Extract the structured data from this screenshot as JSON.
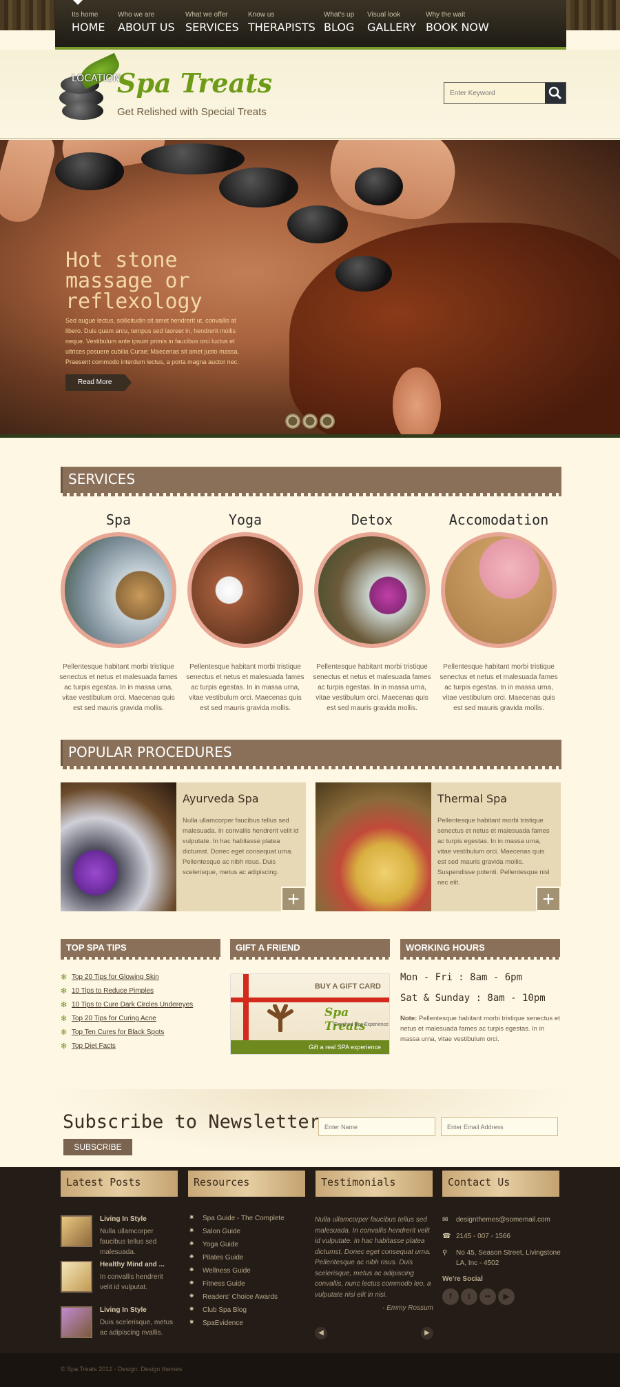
{
  "nav": [
    {
      "sub": "Its home",
      "label": "HOME"
    },
    {
      "sub": "Who we are",
      "label": "ABOUT US"
    },
    {
      "sub": "What we offer",
      "label": "SERVICES"
    },
    {
      "sub": "Know us",
      "label": "THERAPISTS"
    },
    {
      "sub": "What's up",
      "label": "BLOG"
    },
    {
      "sub": "Visual look",
      "label": "GALLERY"
    },
    {
      "sub": "Why the wait",
      "label": "BOOK NOW"
    }
  ],
  "logo": {
    "location": "LOCATION",
    "title": "Spa Treats",
    "tagline": "Get Relished with Special Treats"
  },
  "search": {
    "placeholder": "Enter Keyword"
  },
  "hero": {
    "title": "Hot stone massage or reflexology",
    "text": "Sed augue lectus, sollicitudin sit amet hendrerit ut, convallis at libero. Duis quam arcu, tempus sed laoreet in, hendrerit mollis neque. Vestibulum ante ipsum primis in faucibus orci luctus et ultrices posuere cubilia Curae; Maecenas sit amet justo massa. Praesent commodo interdum lectus, a porta magna auctor nec.",
    "button": "Read More"
  },
  "services": {
    "heading": "SERVICES",
    "items": [
      {
        "label": "Spa",
        "desc": "Pellentesque habitant morbi tristique senectus et netus et malesuada fames ac turpis egestas. In in massa urna, vitae vestibulum orci. Maecenas quis est sed mauris gravida mollis."
      },
      {
        "label": "Yoga",
        "desc": "Pellentesque habitant morbi tristique senectus et netus et malesuada fames ac turpis egestas. In in massa urna, vitae vestibulum orci. Maecenas quis est sed mauris gravida mollis."
      },
      {
        "label": "Detox",
        "desc": "Pellentesque habitant morbi tristique senectus et netus et malesuada fames ac turpis egestas. In in massa urna, vitae vestibulum orci. Maecenas quis est sed mauris gravida mollis."
      },
      {
        "label": "Accomodation",
        "desc": "Pellentesque habitant morbi tristique senectus et netus et malesuada fames ac turpis egestas. In in massa urna, vitae vestibulum orci. Maecenas quis est sed mauris gravida mollis."
      }
    ]
  },
  "procedures": {
    "heading": "POPULAR PROCEDURES",
    "items": [
      {
        "title": "Ayurveda Spa",
        "text": "Nulla ullamcorper faucibus tellus sed malesuada. In convallis hendrerit velit id vulputate. In hac habitasse platea dictumst. Donec eget consequat urna. Pellentesque ac nibh risus. Duis scelerisque, metus ac adipiscing."
      },
      {
        "title": "Thermal Spa",
        "text": "Pellentesque habitant morbi tristique senectus et netus et malesuada fames ac turpis egestas. In in massa urna, vitae vestibulum orci. Maecenas quis est sed mauris gravida mollis. Suspendisse potenti. Pellentesque nisl nec elit."
      }
    ]
  },
  "tips": {
    "heading": "TOP SPA TIPS",
    "items": [
      "Top 20 Tips for Glowing Skin",
      "10 Tips to Reduce Pimples",
      "10 Tips to Cure Dark Circles Undereyes",
      "Top 20 Tips for Curing Acne",
      "Top Ten Cures for Black Spots",
      "Top Diet Facts"
    ]
  },
  "gift": {
    "heading": "GIFT A FRIEND",
    "buy": "BUY A GIFT CARD",
    "title": "Spa Treats",
    "subtitle": "Enriched Spa Experience",
    "footer": "Gift a real SPA experience"
  },
  "hours": {
    "heading": "WORKING HOURS",
    "weekday": "Mon - Fri : 8am - 6pm",
    "weekend": "Sat & Sunday : 8am - 10pm",
    "note_label": "Note:",
    "note": "Pellentesque habitant morbi tristique senectus et netus et malesuada fames ac turpis egestas. In in massa urna, vitae vestibulum orci."
  },
  "newsletter": {
    "title": "Subscribe to Newsletter",
    "name_placeholder": "Enter Name",
    "email_placeholder": "Enter Email Address",
    "button": "SUBSCRIBE"
  },
  "footer": {
    "latest_heading": "Latest Posts",
    "posts": [
      {
        "title": "Living In Style",
        "text": "Nulla ullamcorper faucibus tellus sed malesuada."
      },
      {
        "title": "Healthy Mind and ...",
        "text": "In convallis hendrerit velit id vulputat."
      },
      {
        "title": "Living In Style",
        "text": "Duis scelerisque, metus ac adipiscing nvallis."
      }
    ],
    "resources_heading": "Resources",
    "resources": [
      "Spa Guide - The Complete",
      "Salon Guide",
      "Yoga Guide",
      "Pilates Guide",
      "Wellness Guide",
      "Fitness Guide",
      "Readers' Choice Awards",
      "Club Spa Blog",
      "SpaEvidence"
    ],
    "testimonials_heading": "Testimonials",
    "testimonial": "Nulla ullamcorper faucibus tellus sed malesuada. In convallis hendrerit velit id vulputate. In hac habitasse platea dictumst. Donec eget consequat urna. Pellentesque ac nibh risus. Duis scelerisque, metus ac adipiscing convallis, nunc lectus commodo leo, a vulputate nisi elit in nisi.",
    "testimonial_author": "- Emmy Rossum",
    "contact_heading": "Contact Us",
    "email": "designthemes@somemail.com",
    "phone": "2145 - 007 - 1566",
    "address": "No 45, Season Street, Livingstone LA, Inc - 4502",
    "social_heading": "We're Social",
    "copyright": "© Spa Treats 2012 - Design: Design themes"
  },
  "colors": {
    "accent": "#7a9a2a",
    "bar": "#8a7058",
    "footer": "#231c17"
  }
}
